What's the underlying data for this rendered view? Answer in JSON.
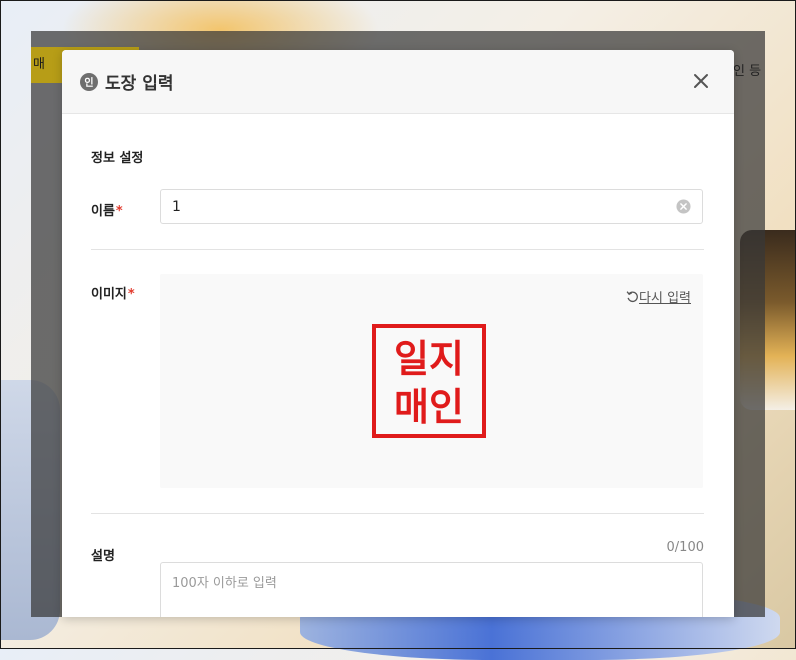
{
  "background": {
    "app_tab_label": "매",
    "app_right_label": "인 등"
  },
  "modal": {
    "icon_label": "인",
    "title": "도장 입력",
    "close_icon": "close-icon",
    "section_title": "정보 설정",
    "name": {
      "label": "이름",
      "required_mark": "*",
      "value": "1",
      "clear_icon": "clear-circle-icon"
    },
    "image": {
      "label": "이미지",
      "required_mark": "*",
      "redo_icon": "undo-arrow-icon",
      "redo_label": "다시 입력",
      "stamp_lines": [
        "일지",
        "매인"
      ],
      "stamp_color": "#e01b1b"
    },
    "description": {
      "label": "설명",
      "counter": "0/100",
      "placeholder": "100자 이하로 입력",
      "value": ""
    }
  }
}
